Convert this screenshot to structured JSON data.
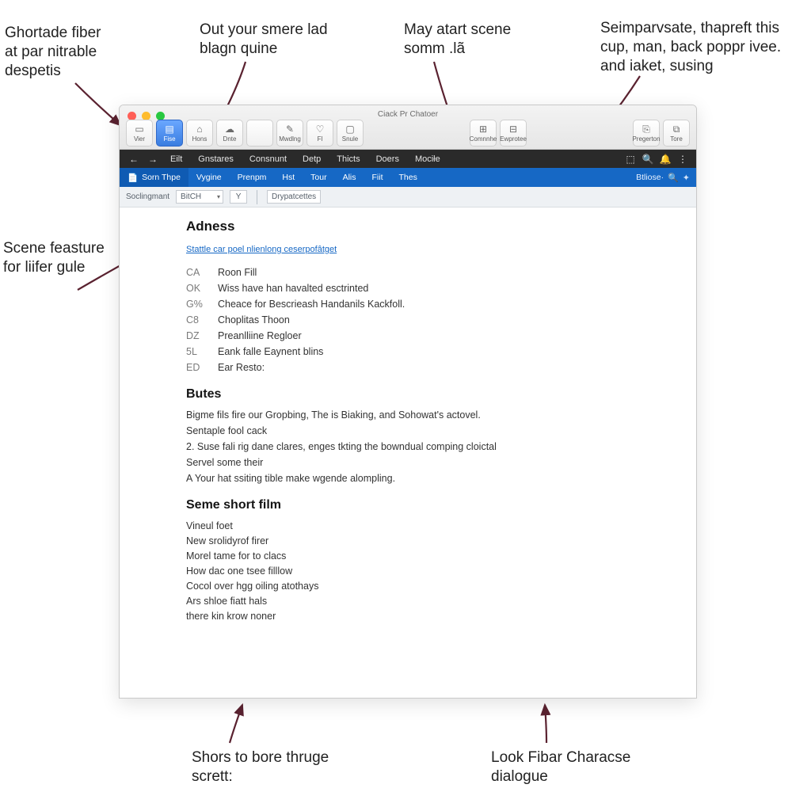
{
  "annotations": {
    "top_left": "Ghortade fiber at par nitrable despetis",
    "top_mid_left": "Out your smere lad blagn quine",
    "top_mid_right": "May atart scene somm .lã",
    "top_right": "Seimparvsate, thapreft this cup, man, back poppr ivee. and iaket, susing",
    "left_mid": "Scene feasture for liifer gule",
    "bottom_left": "Shors to bore thruge scrett:",
    "bottom_right": "Look Fibar Characse dialogue"
  },
  "mac_title": "Ciack Pr Chatoer",
  "mac_toolbar": [
    {
      "id": "view-button",
      "label": "Vier",
      "icon": "▭"
    },
    {
      "id": "file-button",
      "label": "Fise",
      "icon": "▤",
      "sel": true
    },
    {
      "id": "home-button",
      "label": "Hons",
      "icon": "⌂"
    },
    {
      "id": "date-button",
      "label": "Dnte",
      "icon": "☁"
    },
    {
      "id": "sp1",
      "spacer": false
    },
    {
      "id": "marking-button",
      "label": "Mwdlng",
      "icon": "✎"
    },
    {
      "id": "find-button",
      "label": "Fl",
      "icon": "♡"
    },
    {
      "id": "smile-button",
      "label": "Snule",
      "icon": "▢"
    }
  ],
  "mac_toolbar_mid": [
    {
      "id": "comment-button",
      "label": "Comnnhe",
      "icon": "⊞"
    },
    {
      "id": "export-button",
      "label": "Ewprotee",
      "icon": "⊟"
    }
  ],
  "mac_toolbar_right": [
    {
      "id": "properties-button",
      "label": "Pregerton",
      "icon": "⎘"
    },
    {
      "id": "store-button",
      "label": "Tore",
      "icon": "⧉"
    }
  ],
  "dark_menu": {
    "nav": [
      "←",
      "→"
    ],
    "items": [
      "Eilt",
      "Gnstares",
      "Consnunt",
      "Detp",
      "Thicts",
      "Doers",
      "Mociłe"
    ],
    "right_icons": [
      "⬚",
      "🔍",
      "🔔",
      "⋮"
    ]
  },
  "blue_tabs": {
    "first_icon": "📄",
    "first": "Sorn Thpe",
    "tabs": [
      "Vygine",
      "Prenpm",
      "Hst",
      "Tour",
      "Alis",
      "Fiit",
      "Thes"
    ],
    "search_label": "Btliose·",
    "search_icons": [
      "🔍",
      "✦"
    ]
  },
  "filter": {
    "label": "Soclingmant",
    "select_value": "BitCH",
    "mini": "Y",
    "drop": "Drypatcettes"
  },
  "document": {
    "h1": "Adness",
    "sublink": "Stattle car poel nlienlong ceserpofâtget",
    "rows": [
      {
        "code": "CA",
        "text": "Roon Fill"
      },
      {
        "code": "OK",
        "text": "Wiss have han havalted esctrinted"
      },
      {
        "code": "G%",
        "text": "Cheace for Bescrieash Handanils Kackfoll."
      },
      {
        "code": "C8",
        "text": "Choplitas Thoon"
      },
      {
        "code": "DZ",
        "text": "Preanlliine Regloer"
      },
      {
        "code": "5L",
        "text": "Eank falle Eaynent blins"
      },
      {
        "code": "ED",
        "text": "Ear Resto:"
      }
    ],
    "h2": "Butes",
    "paras": [
      "Bigme fils fire our Gropbing, The is Biaking, and Sohowat's actovel.",
      "Sentaple fool cack",
      "2. Suse fali rig dane clares, enges tkting the bowndual comping cloictal",
      "Servel some their",
      "A Your hat ssiting tible make wgende alompling."
    ],
    "h3": "Seme short film",
    "lines": [
      "Vineul foet",
      "New srolidyrof firer",
      "Morel tame for to clacs",
      "How dac one tsee filllow",
      "Cocol over hgg oiling atothays",
      "Ars shloe fiatt hals",
      "there kin krow noner"
    ]
  }
}
